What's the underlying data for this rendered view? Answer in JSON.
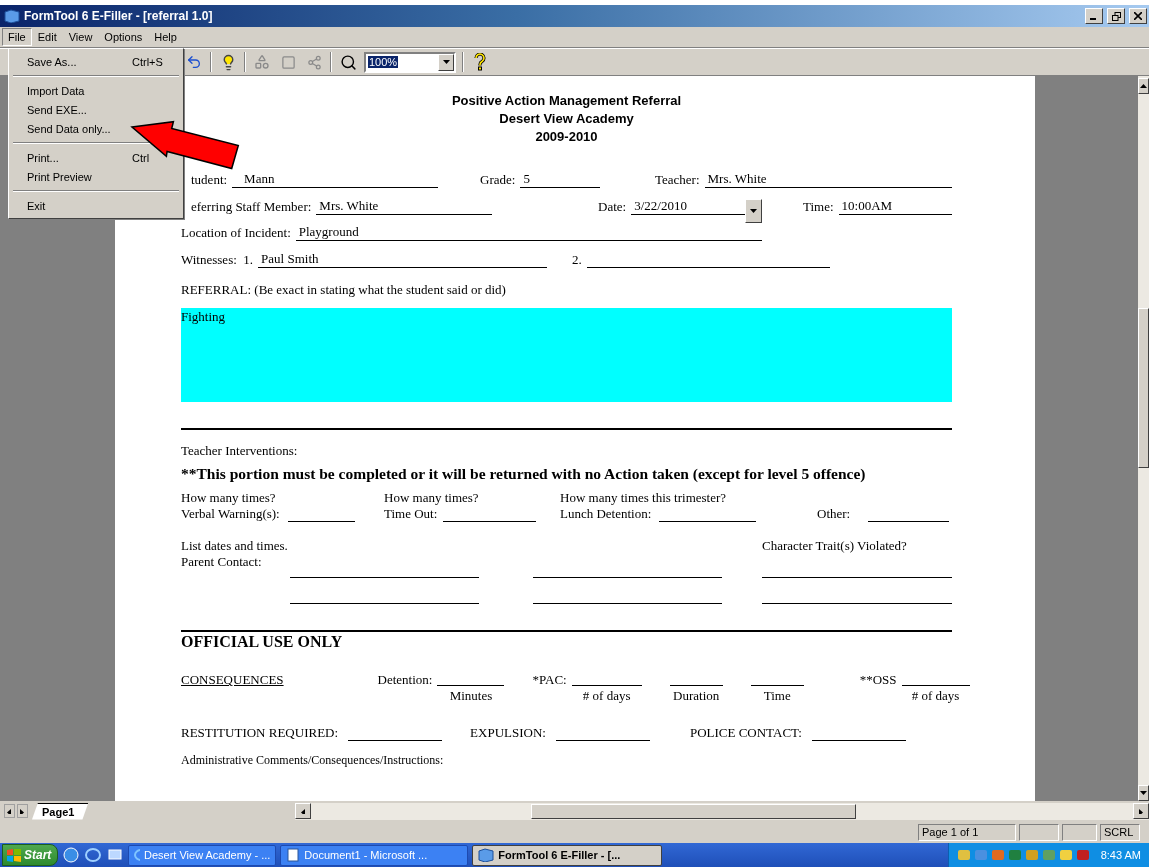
{
  "window": {
    "title": "FormTool 6 E-Filler - [referral 1.0]"
  },
  "menu_bar": [
    {
      "label": "File",
      "selected": true
    },
    {
      "label": "Edit",
      "selected": false
    },
    {
      "label": "View",
      "selected": false
    },
    {
      "label": "Options",
      "selected": false
    },
    {
      "label": "Help",
      "selected": false
    }
  ],
  "file_menu": [
    {
      "kind": "item",
      "label": "Save As...",
      "shortcut": "Ctrl+S"
    },
    {
      "kind": "separator"
    },
    {
      "kind": "item",
      "label": "Import Data"
    },
    {
      "kind": "item",
      "label": "Send EXE..."
    },
    {
      "kind": "item",
      "label": "Send Data only..."
    },
    {
      "kind": "separator"
    },
    {
      "kind": "item",
      "label": "Print...",
      "shortcut": "Ctrl"
    },
    {
      "kind": "item",
      "label": "Print Preview"
    },
    {
      "kind": "separator"
    },
    {
      "kind": "item",
      "label": "Exit"
    }
  ],
  "toolbar": {
    "zoom": "100%"
  },
  "form": {
    "header": [
      "Positive Action Management Referral",
      "Desert View Academy",
      "2009-2010"
    ],
    "rows": [
      [
        {
          "kind": "text",
          "label": "tudent:",
          "value": "Mann"
        },
        {
          "kind": "text",
          "label": "Grade:",
          "value": "5"
        },
        {
          "kind": "text",
          "label": "Teacher:",
          "value": "Mrs. White"
        }
      ],
      [
        {
          "kind": "text",
          "label": "eferring Staff Member:",
          "value": "Mrs. White"
        },
        {
          "kind": "date",
          "label": "Date:",
          "value": "3/22/2010"
        },
        {
          "kind": "text",
          "label": "Time:",
          "value": "10:00AM"
        }
      ],
      [
        {
          "kind": "text",
          "label": "Location of Incident:",
          "value": "Playground"
        }
      ],
      [
        {
          "kind": "text",
          "label": "Witnesses:  1.",
          "value": "Paul Smith"
        },
        {
          "kind": "text",
          "label": "2."
        }
      ]
    ],
    "referral_label": "REFERRAL: (Be exact in stating what the student said or did)",
    "referral_text": "Fighting",
    "interventions_label": "Teacher Interventions:",
    "notice": "**This portion must be completed or it will be returned with no Action taken (except for level 5 offence)",
    "counts": [
      {
        "question": "How many times?",
        "label": "Verbal Warning(s):"
      },
      {
        "question": "How many times?",
        "label": "Time Out:"
      },
      {
        "question": "How many times this trimester?",
        "label": "Lunch Detention:"
      },
      {
        "label": "Other:"
      }
    ],
    "list_dates": "List dates and times.",
    "parent_contact": "Parent Contact:",
    "character_trait": "Character Trait(s) Violated?",
    "official_heading": "OFFICIAL USE ONLY",
    "consequences_heading": "CONSEQUENCES",
    "consequences": [
      {
        "label": "Detention:",
        "caption": "Minutes"
      },
      {
        "label": "*PAC:",
        "caption": "# of days"
      },
      {
        "caption": "Duration"
      },
      {
        "caption": "Time"
      },
      {
        "label": "**OSS",
        "caption": "# of days"
      }
    ],
    "other_actions": [
      {
        "label": "RESTITUTION REQUIRED:"
      },
      {
        "label": "EXPULSION:"
      },
      {
        "label": "POLICE CONTACT:"
      }
    ],
    "admin_comments": "Administrative Comments/Consequences/Instructions:"
  },
  "page_tabs": [
    {
      "label": "Page1",
      "selected": true
    }
  ],
  "status_bar": {
    "page": "Page 1 of 1",
    "mode": "SCRL"
  },
  "taskbar": {
    "start": "Start",
    "tasks": [
      {
        "kind": "browser",
        "label": "Desert View Academy - ...",
        "selected": false
      },
      {
        "kind": "document",
        "label": "Document1 - Microsoft ...",
        "selected": false
      },
      {
        "kind": "app",
        "label": "FormTool 6 E-Filler - [...",
        "selected": true
      }
    ],
    "clock": "8:43 AM"
  }
}
